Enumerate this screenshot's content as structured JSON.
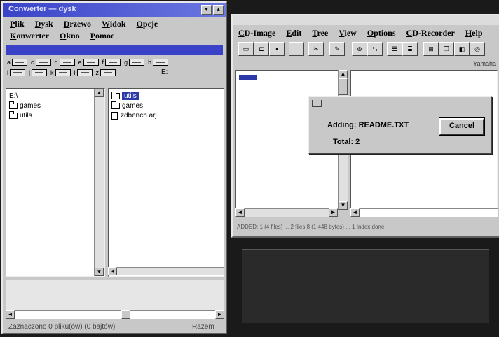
{
  "left_window": {
    "title": "Conwerter — dysk",
    "menu_row1": [
      "Plik",
      "Dysk",
      "Drzewo",
      "Widok",
      "Opcje"
    ],
    "menu_row2": [
      "Konwerter",
      "Okno",
      "Pomoc"
    ],
    "drives": [
      "a",
      "c",
      "d",
      "e",
      "f",
      "g",
      "h",
      "i",
      "j",
      "k",
      "l",
      "z"
    ],
    "path_label": "E:",
    "tree_root": "E:\\",
    "tree_items": [
      "games",
      "utils"
    ],
    "files": [
      {
        "name": "utils",
        "type": "folder",
        "selected": true
      },
      {
        "name": "games",
        "type": "folder",
        "selected": false
      },
      {
        "name": "zdbench.arj",
        "type": "file",
        "selected": false
      }
    ],
    "status_left": "Zaznaczono 0 pliku(ów) (0 bajtów)",
    "status_right": "Razem"
  },
  "right_window": {
    "menu": [
      "CD-Image",
      "Edit",
      "Tree",
      "View",
      "Options",
      "CD-Recorder",
      "Help"
    ],
    "toolbar_label": "Yamaha",
    "status_text": "ADDED: 1 (4 files) ... 2 files 8 (1,448 bytes) ... 1 Index done",
    "dialog": {
      "adding_label": "Adding: README.TXT",
      "total_label": "Total: 2",
      "cancel_label": "Cancel"
    }
  },
  "colors": {
    "titlebar_active": "#3a43c8",
    "selection": "#2b3aa8",
    "window_face": "#c8c8c8",
    "desktop": "#1a1a1a"
  }
}
